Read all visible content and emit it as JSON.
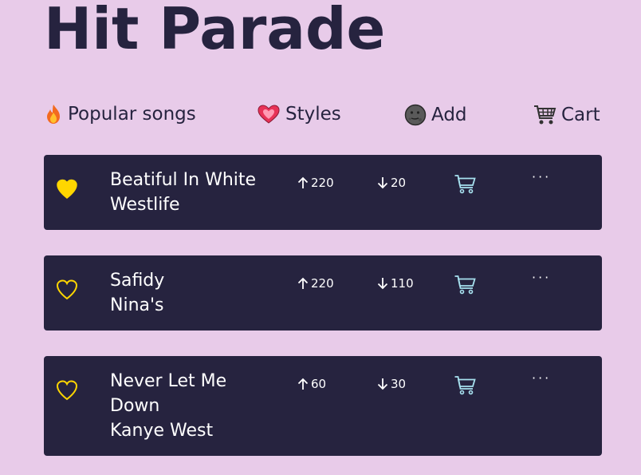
{
  "page": {
    "title": "Hit Parade"
  },
  "nav": [
    {
      "label": "Popular songs",
      "icon": "fire-icon"
    },
    {
      "label": "Styles",
      "icon": "sparkling-heart-icon"
    },
    {
      "label": "Add",
      "icon": "new-moon-face-icon"
    },
    {
      "label": "Cart",
      "icon": "shopping-cart-icon"
    }
  ],
  "colors": {
    "background": "#e8cbe9",
    "card": "#26233f",
    "accent": "#ffd600",
    "cart": "#a7e1ef"
  },
  "songs": [
    {
      "title": "Beatiful In White",
      "artist": "Westlife",
      "likes": "220",
      "dislikes": "20",
      "favorited": true,
      "more": "···"
    },
    {
      "title": "Safidy",
      "artist": "Nina's",
      "likes": "220",
      "dislikes": "110",
      "favorited": false,
      "more": "···"
    },
    {
      "title": "Never Let Me Down",
      "artist": "Kanye West",
      "likes": "60",
      "dislikes": "30",
      "favorited": false,
      "more": "···"
    }
  ]
}
